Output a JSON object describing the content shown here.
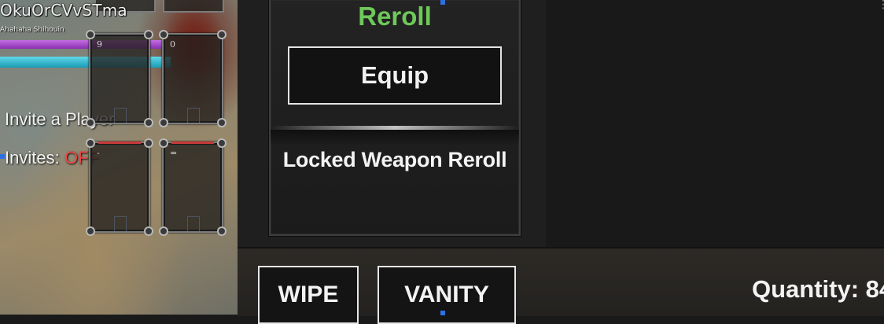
{
  "player": {
    "name": "OkuOrCVvSTma",
    "subtitle": "Ahahaha Shihouin",
    "health_fill": 0.97,
    "mana_fill": 1.0
  },
  "party": {
    "invite_label": "Invite a Player",
    "invites_label": "Invites:",
    "invites_state": "OFF"
  },
  "hotbar": {
    "slots": [
      {
        "key": "9"
      },
      {
        "key": "0"
      },
      {
        "key": "-"
      },
      {
        "key": "="
      }
    ]
  },
  "weapon_panel": {
    "reroll_label": "Reroll",
    "equip_label": "Equip",
    "locked_label": "Locked Weapon Reroll"
  },
  "bottom_bar": {
    "wipe_label": "WIPE",
    "vanity_label": "VANITY",
    "quantity_label": "Quantity: 84"
  },
  "colors": {
    "reroll_green": "#6ec85a",
    "invites_off_red": "#f04a4a",
    "health_bar": "#a54fd0",
    "mana_bar": "#2fb4cc"
  },
  "icons": {
    "menu": "more-vertical-icon"
  }
}
